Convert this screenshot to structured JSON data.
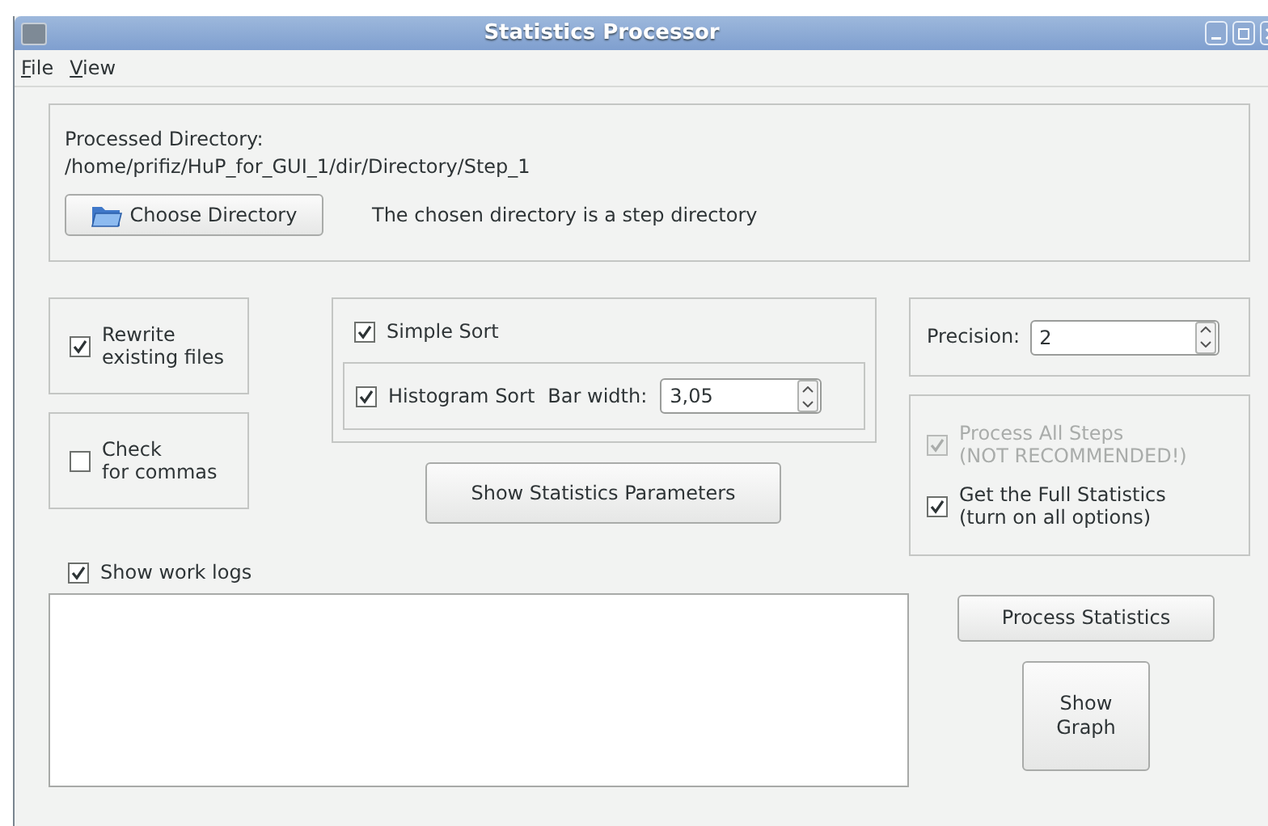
{
  "window": {
    "title": "Statistics Processor"
  },
  "menu": [
    {
      "label": "File"
    },
    {
      "label": "View"
    }
  ],
  "directory": {
    "heading": "Processed Directory:",
    "path": "/home/prifiz/HuP_for_GUI_1/dir/Directory/Step_1",
    "button": "Choose Directory",
    "status": "The chosen directory is a step directory"
  },
  "file_options": [
    {
      "label": "Rewrite\nexisting files",
      "checked": true
    },
    {
      "label": "Check\nfor commas",
      "checked": false
    }
  ],
  "sorting": {
    "simple": {
      "label": "Simple Sort",
      "checked": true
    },
    "histogram": {
      "label": "Histogram Sort",
      "checked": true
    },
    "bar_width": {
      "label": "Bar width:",
      "value": "3,05"
    },
    "button": "Show Statistics Parameters"
  },
  "precision": {
    "label": "Precision:",
    "value": "2"
  },
  "run_options": [
    {
      "label": "Process All Steps\n(NOT RECOMMENDED!)",
      "checked": true,
      "disabled": true
    },
    {
      "label": "Get the Full Statistics\n(turn on all options)",
      "checked": true,
      "disabled": false
    }
  ],
  "show_logs": {
    "label": "Show work logs",
    "checked": true
  },
  "actions": [
    {
      "label": "Process Statistics",
      "kind": "wide"
    },
    {
      "label": "Show\nGraph",
      "kind": "tall"
    }
  ]
}
